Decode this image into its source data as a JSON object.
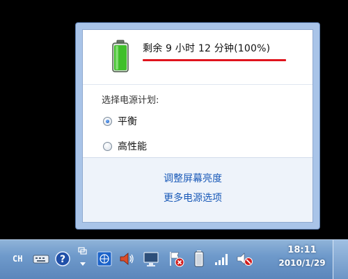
{
  "flyout": {
    "battery_status": "剩余 9 小时 12 分钟(100%)",
    "battery_percent": 100,
    "plan_heading": "选择电源计划:",
    "plans": [
      {
        "label": "平衡",
        "selected": true
      },
      {
        "label": "高性能",
        "selected": false
      }
    ],
    "links": {
      "adjust_brightness": "调整屏幕亮度",
      "more_power_options": "更多电源选项"
    },
    "colors": {
      "battery_green": "#3fbf2a",
      "link_blue": "#1a5ab8",
      "highlight_red": "#e0141d"
    }
  },
  "taskbar": {
    "language": "CH",
    "time": "18:11",
    "date": "2010/1/29",
    "tray_icons": [
      "keyboard-icon",
      "help-icon",
      "expand-tray-icon",
      "network-map-icon",
      "speaker-icon",
      "monitor-icon",
      "action-center-flag-icon",
      "battery-icon",
      "signal-strength-icon",
      "volume-muted-icon"
    ]
  }
}
